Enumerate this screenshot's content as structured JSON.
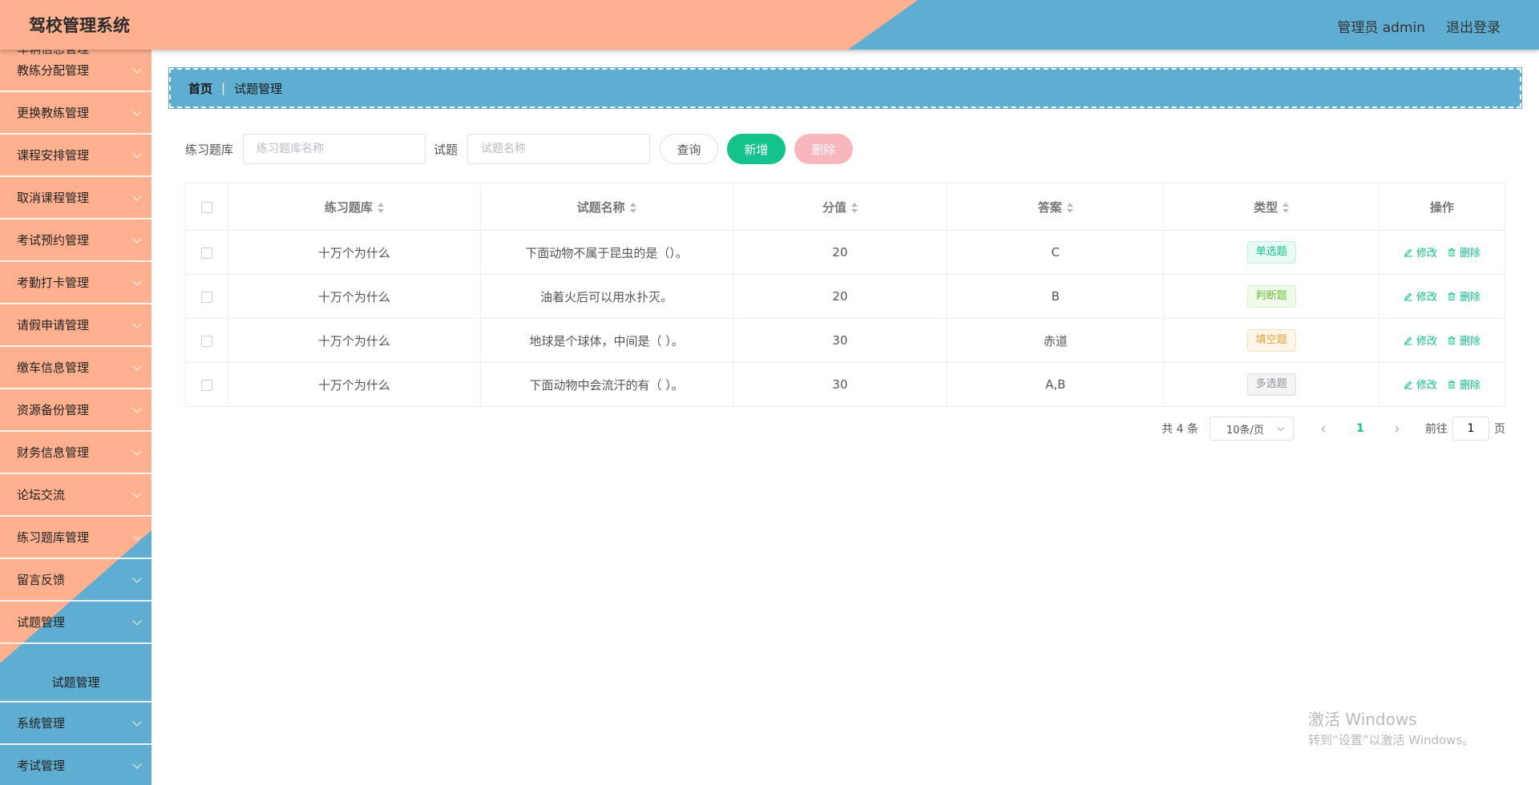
{
  "header": {
    "app_title": "驾校管理系统",
    "user_label": "管理员 admin",
    "logout_label": "退出登录"
  },
  "sidebar": {
    "partial_top_label": "车辆信息管理",
    "items": [
      {
        "label": "教练分配管理"
      },
      {
        "label": "更换教练管理"
      },
      {
        "label": "课程安排管理"
      },
      {
        "label": "取消课程管理"
      },
      {
        "label": "考试预约管理"
      },
      {
        "label": "考勤打卡管理"
      },
      {
        "label": "请假申请管理"
      },
      {
        "label": "缴车信息管理"
      },
      {
        "label": "资源备份管理"
      },
      {
        "label": "财务信息管理"
      },
      {
        "label": "论坛交流"
      },
      {
        "label": "练习题库管理"
      },
      {
        "label": "留言反馈"
      },
      {
        "label": "试题管理"
      },
      {
        "label": "系统管理"
      },
      {
        "label": "考试管理"
      }
    ],
    "active_sub_item": "试题管理",
    "colors": {
      "salmon": "#ffb18f",
      "blue": "#5fadd0"
    }
  },
  "breadcrumb": {
    "home": "首页",
    "separator": "|",
    "current": "试题管理"
  },
  "search": {
    "bank_label": "练习题库",
    "bank_placeholder": "练习题库名称",
    "bank_value": "",
    "question_label": "试题",
    "question_placeholder": "试题名称",
    "question_value": "",
    "query_button": "查询",
    "add_button": "新增",
    "delete_button": "删除"
  },
  "table": {
    "columns": [
      "练习题库",
      "试题名称",
      "分值",
      "答案",
      "类型",
      "操作"
    ],
    "rows": [
      {
        "bank": "十万个为什么",
        "name": "下面动物不属于昆虫的是（）。",
        "score": "20",
        "answer": "C",
        "type": "单选题",
        "edit": "修改",
        "delete": "删除"
      },
      {
        "bank": "十万个为什么",
        "name": "油着火后可以用水扑灭。",
        "score": "20",
        "answer": "B",
        "type": "判断题",
        "edit": "修改",
        "delete": "删除"
      },
      {
        "bank": "十万个为什么",
        "name": "地球是个球体，中间是（ ）。",
        "score": "30",
        "answer": "赤道",
        "type": "填空题",
        "edit": "修改",
        "delete": "删除"
      },
      {
        "bank": "十万个为什么",
        "name": "下面动物中会流汗的有（ ）。",
        "score": "30",
        "answer": "A,B",
        "type": "多选题",
        "edit": "修改",
        "delete": "删除"
      }
    ]
  },
  "pagination": {
    "total_text": "共 4 条",
    "page_size": "10条/页",
    "current_page": "1",
    "goto_label": "前往",
    "goto_value": "1",
    "page_unit": "页"
  },
  "watermark": {
    "title": "激活 Windows",
    "subtitle": "转到“设置”以激活 Windows。"
  }
}
